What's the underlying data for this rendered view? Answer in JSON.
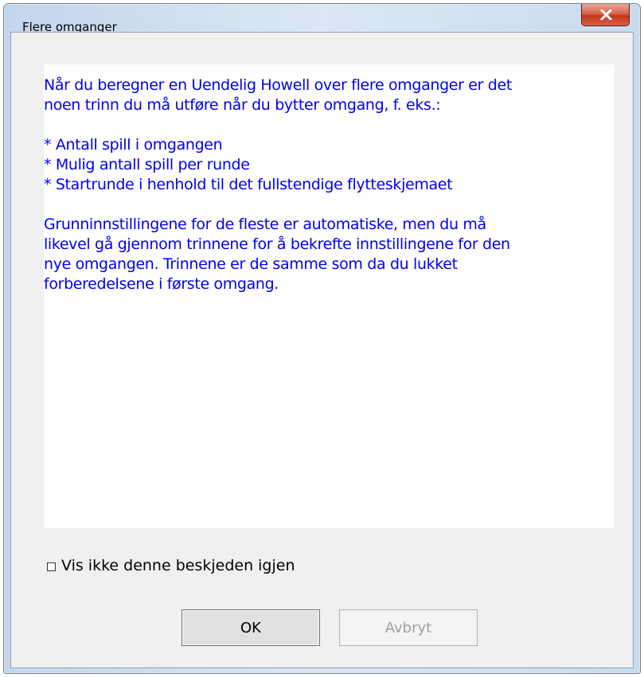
{
  "window": {
    "title": "Flere omganger",
    "close_icon": "close-icon"
  },
  "message": {
    "lines": [
      "Når du beregner en Uendelig Howell over flere omganger er det",
      "noen trinn du må utføre når du bytter omgang, f. eks.:",
      "",
      "* Antall spill i omgangen",
      "* Mulig antall spill per runde",
      "* Startrunde i henhold til det fullstendige flytteskjemaet",
      "",
      "Grunninnstillingene for de fleste er automatiske, men du må",
      "likevel gå gjennom trinnene for å bekrefte innstillingene for den",
      "nye omgangen. Trinnene er de samme som da du lukket",
      "forberedelsene i første omgang."
    ],
    "text_color": "#0000ee"
  },
  "checkbox": {
    "label": "Vis ikke denne beskjeden igjen",
    "checked": false
  },
  "buttons": {
    "ok_label": "OK",
    "cancel_label": "Avbryt",
    "cancel_enabled": false
  }
}
